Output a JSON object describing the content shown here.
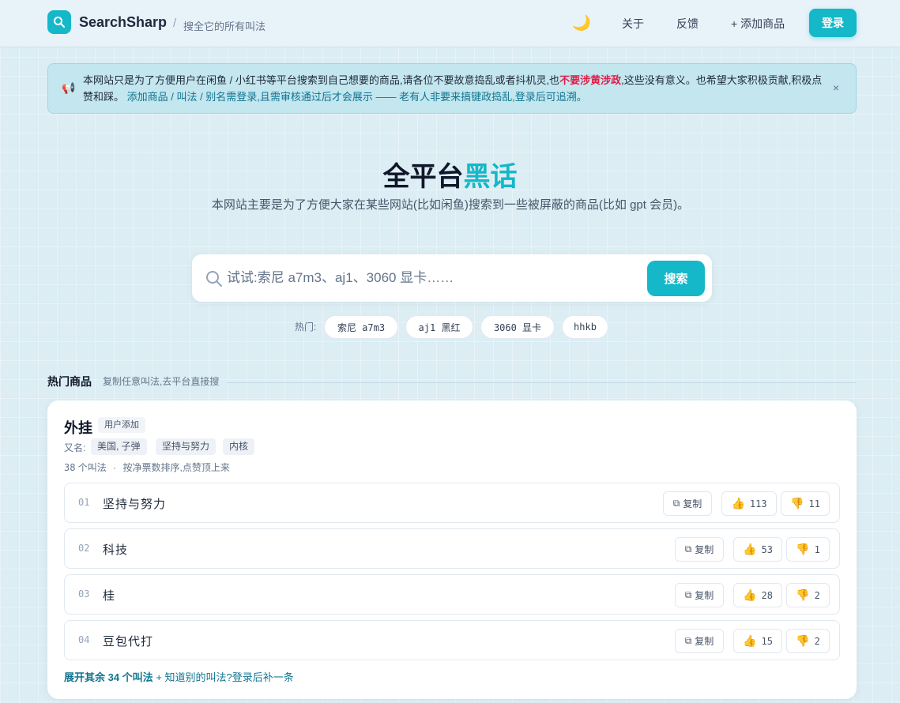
{
  "header": {
    "brand": "SearchSharp",
    "separator": "/",
    "tagline": "搜全它的所有叫法",
    "theme_icon": "moon-icon",
    "nav": {
      "about": "关于",
      "feedback": "反馈",
      "add_product": "+ 添加商品"
    },
    "login": "登录"
  },
  "notice": {
    "icon": "megaphone-icon",
    "text_1": "本网站只是为了方便用户在闲鱼 / 小红书等平台搜索到自己想要的商品,请各位不要故意捣乱或者抖机灵,也",
    "text_red": "不要涉黄涉政",
    "text_2": ",这些没有意义。也希望大家积极贡献,积极点赞和踩。",
    "text_teal": "添加商品 / 叫法 / 别名需登录,且需审核通过后才会展示 —— 老有人非要来搞键政捣乱,登录后可追溯。",
    "close": "×"
  },
  "hero": {
    "title_main": "全平台",
    "title_accent": "黑话",
    "subtitle": "本网站主要是为了方便大家在某些网站(比如闲鱼)搜索到一些被屏蔽的商品(比如 gpt 会员)。"
  },
  "search": {
    "placeholder": "试试:索尼 a7m3、aj1、3060 显卡……",
    "button": "搜索",
    "hot_label": "热门:",
    "hot": [
      "索尼 a7m3",
      "aj1 黑红",
      "3060 显卡",
      "hhkb"
    ]
  },
  "section": {
    "title": "热门商品",
    "subtitle": "复制任意叫法,去平台直接搜"
  },
  "card": {
    "title": "外挂",
    "badge": "用户添加",
    "alias_label": "又名:",
    "aliases": [
      "美国, 子弹",
      "坚持与努力",
      "内核"
    ],
    "count": "38",
    "count_label": "个叫法",
    "dot": "·",
    "sort_note": "按净票数排序,点赞顶上来",
    "copy_label": "复制",
    "rows": [
      {
        "num": "01",
        "name": "坚持与努力",
        "up": "113",
        "down": "11"
      },
      {
        "num": "02",
        "name": "科技",
        "up": "53",
        "down": "1"
      },
      {
        "num": "03",
        "name": "桂",
        "up": "28",
        "down": "2"
      },
      {
        "num": "04",
        "name": "豆包代打",
        "up": "15",
        "down": "2"
      }
    ],
    "expand_bold": "展开其余 34 个叫法",
    "expand_more": "+ 知道别的叫法?登录后补一条"
  },
  "colors": {
    "accent": "#14b8c8",
    "warning": "#e11d48",
    "teal_text": "#0e7490"
  }
}
